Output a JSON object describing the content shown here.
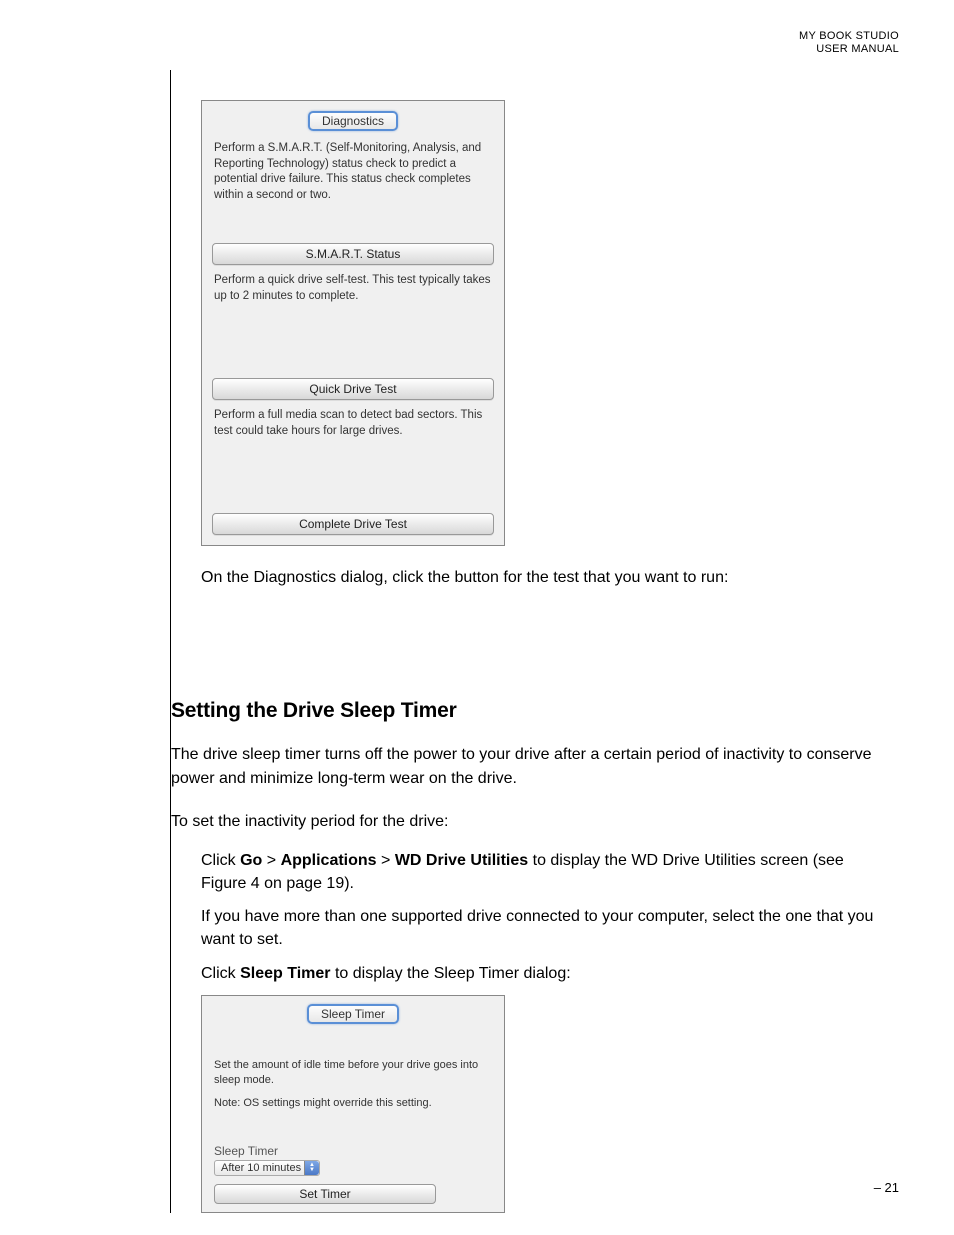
{
  "header": {
    "line1": "MY BOOK STUDIO",
    "line2": "USER MANUAL"
  },
  "diagnostics_dialog": {
    "tab_label": "Diagnostics",
    "section1_text": "Perform a S.M.A.R.T. (Self-Monitoring, Analysis, and Reporting Technology) status check to predict a potential drive failure. This status check completes within a second or two.",
    "button1": "S.M.A.R.T. Status",
    "section2_text": "Perform a quick drive self-test. This test typically takes up to 2 minutes to complete.",
    "button2": "Quick Drive Test",
    "section3_text": "Perform a full media scan to detect bad sectors. This test could take hours for large drives.",
    "button3": "Complete Drive Test"
  },
  "body": {
    "caption1": "On the Diagnostics dialog, click the button for the test that you want to run:",
    "heading": "Setting the Drive Sleep Timer",
    "para1": "The drive sleep timer turns off the power to your drive after a certain period of inactivity to conserve power and minimize long-term wear on the drive.",
    "para2": "To set the inactivity period for the drive:",
    "step1_pre": "Click ",
    "step1_b1": "Go",
    "step1_gt1": " > ",
    "step1_b2": "Applications",
    "step1_gt2": " > ",
    "step1_b3": "WD Drive Utilities",
    "step1_post": " to display the WD Drive Utilities screen (see Figure 4 on page 19).",
    "step2": "If you have more than one supported drive connected to your computer, select the one that you want to set.",
    "step3_pre": "Click ",
    "step3_b1": "Sleep Timer",
    "step3_post": " to display the Sleep Timer dialog:"
  },
  "sleep_dialog": {
    "tab_label": "Sleep Timer",
    "text1": "Set the amount of idle time before your drive goes into sleep mode.",
    "text2": "Note: OS settings might override this setting.",
    "label": "Sleep Timer",
    "dropdown_value": "After 10 minutes",
    "button": "Set Timer"
  },
  "footer": {
    "page": "– 21"
  }
}
